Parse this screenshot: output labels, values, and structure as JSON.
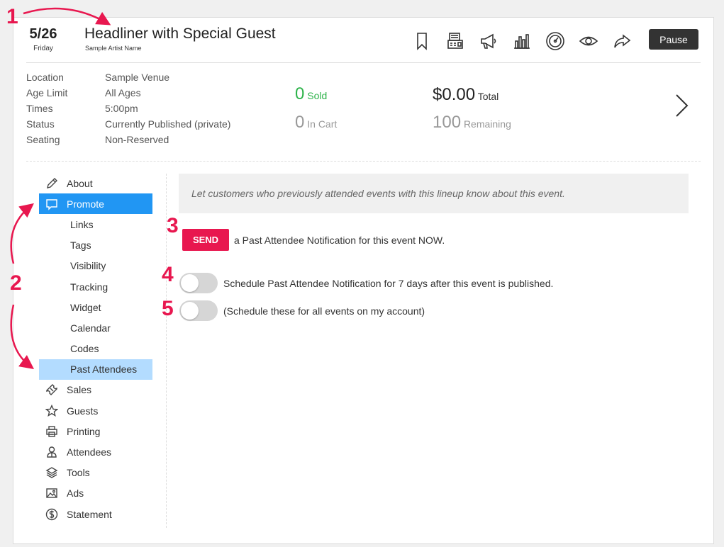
{
  "event": {
    "date": "5/26",
    "day": "Friday",
    "title": "Headliner with Special Guest",
    "artist": "Sample Artist Name"
  },
  "toolbar": {
    "icons": [
      "bookmark-icon",
      "box-office-icon",
      "megaphone-icon",
      "bar-chart-icon",
      "dashboard-gauge-icon",
      "eye-icon",
      "share-icon"
    ],
    "pause_label": "Pause"
  },
  "info": {
    "rows": [
      {
        "label": "Location",
        "value": "Sample Venue"
      },
      {
        "label": "Age Limit",
        "value": "All Ages"
      },
      {
        "label": "Times",
        "value": "5:00pm"
      },
      {
        "label": "Status",
        "value": "Currently Published (private)"
      },
      {
        "label": "Seating",
        "value": "Non-Reserved"
      }
    ]
  },
  "stats": {
    "sold": "0",
    "sold_label": "Sold",
    "cart": "0",
    "cart_label": "In Cart",
    "total": "$0.00",
    "total_label": "Total",
    "remaining": "100",
    "remaining_label": "Remaining"
  },
  "sidebar": {
    "items": [
      {
        "label": "About",
        "icon": "pencil-icon"
      },
      {
        "label": "Promote",
        "icon": "speech-bubble-icon",
        "active": true
      },
      {
        "label": "Sales",
        "icon": "ticket-icon"
      },
      {
        "label": "Guests",
        "icon": "star-icon"
      },
      {
        "label": "Printing",
        "icon": "printer-icon"
      },
      {
        "label": "Attendees",
        "icon": "person-icon"
      },
      {
        "label": "Tools",
        "icon": "layers-icon"
      },
      {
        "label": "Ads",
        "icon": "image-icon"
      },
      {
        "label": "Statement",
        "icon": "dollar-circle-icon"
      }
    ],
    "promote_subitems": [
      "Links",
      "Tags",
      "Visibility",
      "Tracking",
      "Widget",
      "Calendar",
      "Codes",
      "Past Attendees"
    ],
    "selected_subitem": "Past Attendees"
  },
  "content": {
    "banner": "Let customers who previously attended events with this lineup know about this event.",
    "send_label": "SEND",
    "send_text": "a Past Attendee Notification for this event NOW.",
    "toggle_1_text": "Schedule Past Attendee Notification for 7 days after this event is published.",
    "toggle_1_on": false,
    "toggle_2_text": "(Schedule these for all events on my account)",
    "toggle_2_on": false
  },
  "annotations": {
    "labels": [
      "1",
      "2",
      "3",
      "4",
      "5"
    ],
    "color": "#e8174f"
  },
  "colors": {
    "accent_blue": "#2196f3",
    "selected_light_blue": "#b3dcff",
    "send_red": "#e8174f",
    "sold_green": "#2db34a"
  }
}
